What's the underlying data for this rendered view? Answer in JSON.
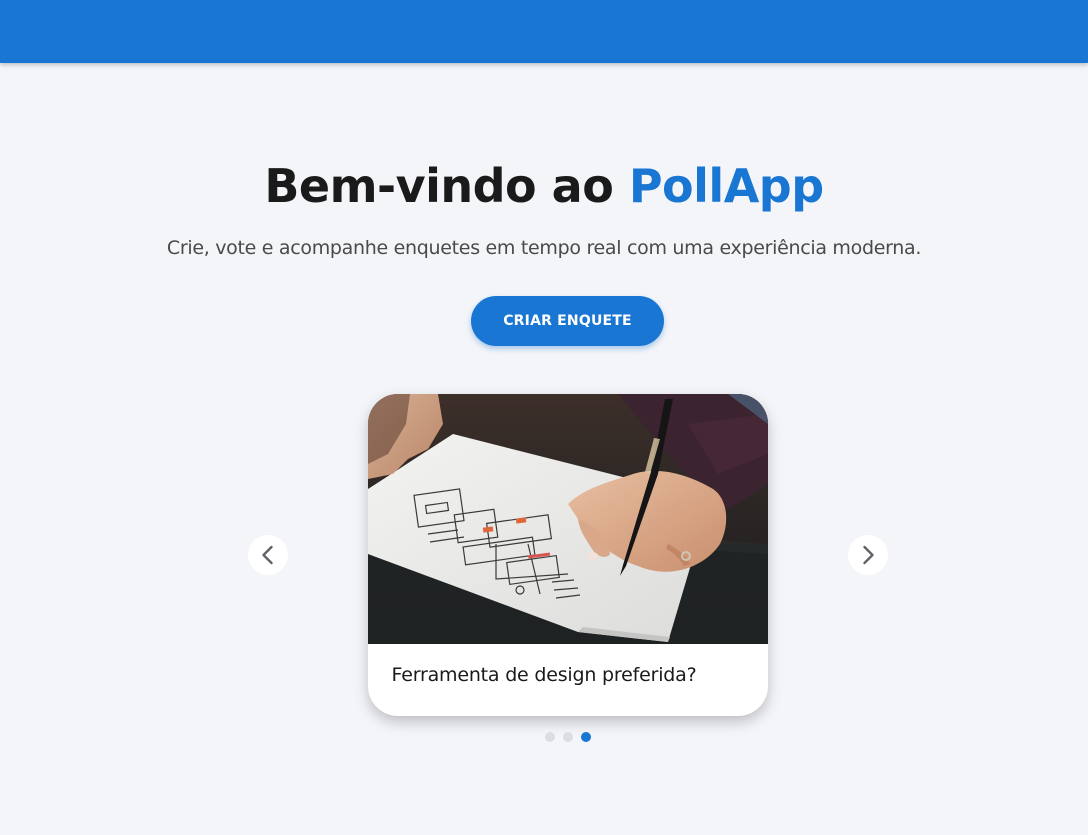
{
  "header": {
    "color": "#1976d2"
  },
  "hero": {
    "title_prefix": "Bem-vindo ao ",
    "title_brand": "PollApp",
    "subtitle": "Crie, vote e acompanhe enquetes em tempo real com uma experiência moderna.",
    "cta_label": "CRIAR ENQUETE"
  },
  "carousel": {
    "current_slide": {
      "title": "Ferramenta de design preferida?",
      "image": "hand-sketching-wireframe-photo"
    },
    "prev_icon": "chevron-left-icon",
    "next_icon": "chevron-right-icon",
    "dots_count": 3,
    "active_dot": 3
  },
  "colors": {
    "accent": "#1976d2",
    "background": "#f4f5f9",
    "dot_inactive": "#dcdde3"
  }
}
